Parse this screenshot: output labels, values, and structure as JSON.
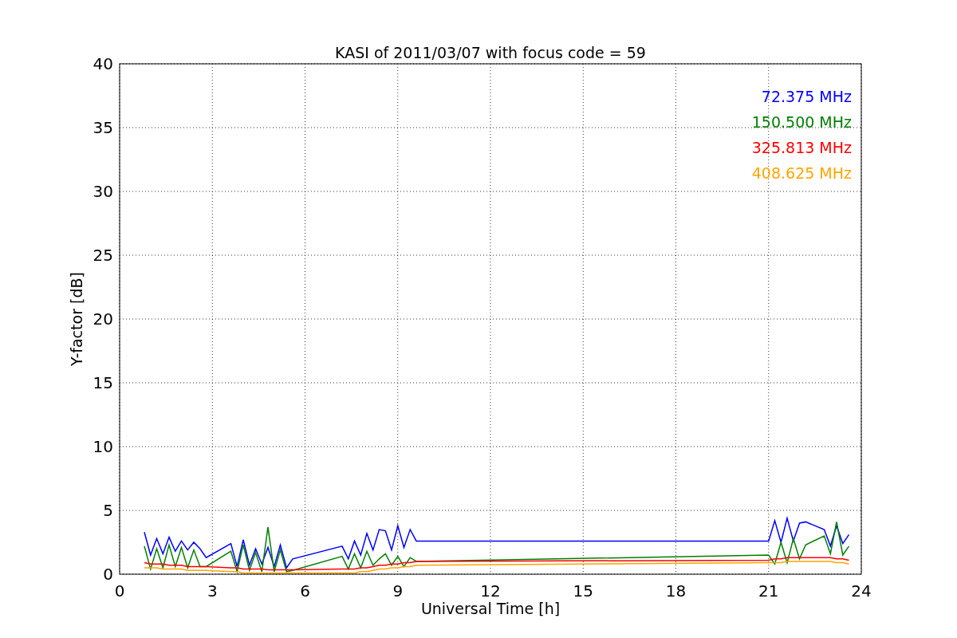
{
  "chart_data": {
    "type": "line",
    "title": "KASI of 2011/03/07 with focus code = 59",
    "xlabel": "Universal Time [h]",
    "ylabel": "Y-factor [dB]",
    "x": [
      0.8,
      1.0,
      1.2,
      1.4,
      1.6,
      1.8,
      2.0,
      2.2,
      2.4,
      2.6,
      2.8,
      3.6,
      3.8,
      4.0,
      4.2,
      4.4,
      4.6,
      4.8,
      5.0,
      5.2,
      5.4,
      5.6,
      7.2,
      7.4,
      7.6,
      7.8,
      8.0,
      8.2,
      8.4,
      8.6,
      8.8,
      9.0,
      9.2,
      9.4,
      9.6,
      21.0,
      21.2,
      21.4,
      21.6,
      21.8,
      22.0,
      22.2,
      22.8,
      23.0,
      23.2,
      23.4,
      23.6
    ],
    "series": [
      {
        "name": "72.375 MHz",
        "color": "#0000ff",
        "values": [
          3.3,
          1.5,
          2.8,
          1.6,
          2.9,
          1.8,
          2.6,
          1.9,
          2.5,
          2.0,
          1.3,
          2.4,
          0.6,
          2.7,
          0.7,
          2.0,
          0.8,
          2.1,
          0.6,
          2.3,
          0.5,
          1.2,
          2.2,
          1.2,
          2.6,
          1.5,
          3.2,
          1.9,
          3.5,
          3.4,
          1.9,
          3.8,
          2.1,
          3.5,
          2.6,
          2.6,
          4.2,
          2.5,
          4.4,
          2.6,
          4.0,
          4.1,
          3.5,
          2.2,
          3.8,
          2.4,
          3.1
        ]
      },
      {
        "name": "150.500 MHz",
        "color": "#008000",
        "values": [
          2.2,
          0.4,
          2.0,
          0.5,
          2.3,
          0.6,
          2.1,
          0.5,
          1.9,
          0.6,
          0.6,
          1.8,
          0.2,
          2.3,
          0.3,
          1.7,
          0.2,
          3.7,
          0.2,
          1.9,
          0.2,
          0.3,
          1.4,
          0.4,
          1.6,
          0.5,
          1.8,
          0.7,
          1.2,
          1.6,
          0.7,
          1.4,
          0.6,
          1.3,
          1.0,
          1.5,
          0.8,
          2.5,
          0.9,
          2.8,
          1.2,
          2.3,
          3.0,
          1.6,
          4.1,
          1.5,
          2.2
        ]
      },
      {
        "name": "325.813 MHz",
        "color": "#ff0000",
        "values": [
          0.9,
          0.8,
          0.8,
          0.8,
          0.7,
          0.7,
          0.7,
          0.6,
          0.6,
          0.6,
          0.6,
          0.5,
          0.5,
          0.4,
          0.4,
          0.4,
          0.4,
          0.35,
          0.35,
          0.35,
          0.35,
          0.35,
          0.4,
          0.4,
          0.4,
          0.5,
          0.5,
          0.6,
          0.7,
          0.7,
          0.8,
          0.8,
          0.9,
          0.9,
          1.0,
          1.1,
          1.2,
          1.2,
          1.3,
          1.3,
          1.3,
          1.3,
          1.3,
          1.3,
          1.2,
          1.2,
          1.1
        ]
      },
      {
        "name": "408.625 MHz",
        "color": "#ffa500",
        "values": [
          0.5,
          0.5,
          0.5,
          0.4,
          0.4,
          0.4,
          0.4,
          0.3,
          0.3,
          0.3,
          0.3,
          0.2,
          0.2,
          0.1,
          0.1,
          0.1,
          0.1,
          0.1,
          0.1,
          0.1,
          0.1,
          0.1,
          0.1,
          0.1,
          0.1,
          0.2,
          0.2,
          0.3,
          0.4,
          0.4,
          0.5,
          0.5,
          0.6,
          0.6,
          0.7,
          0.9,
          0.9,
          0.9,
          1.0,
          1.0,
          1.0,
          1.0,
          1.0,
          1.0,
          0.9,
          0.9,
          0.8
        ]
      }
    ],
    "grid": true,
    "xlim": [
      0,
      24
    ],
    "ylim": [
      0,
      40
    ],
    "xticks": [
      0,
      3,
      6,
      9,
      12,
      15,
      18,
      21,
      24
    ],
    "yticks": [
      0,
      5,
      10,
      15,
      20,
      25,
      30,
      35,
      40
    ]
  }
}
